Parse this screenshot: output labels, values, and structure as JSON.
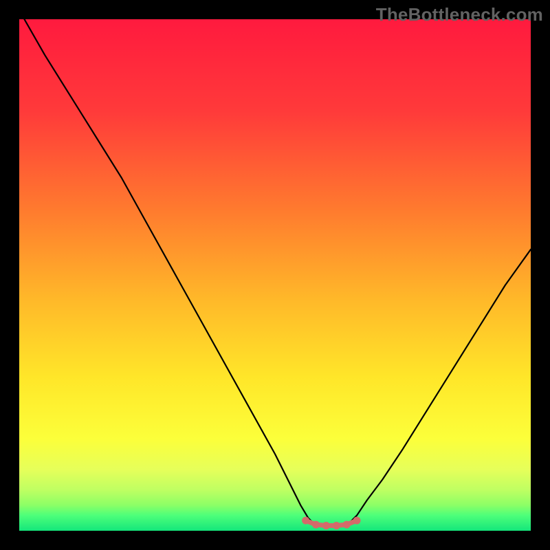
{
  "watermark": "TheBottleneck.com",
  "chart_data": {
    "type": "line",
    "title": "",
    "xlabel": "",
    "ylabel": "",
    "xlim": [
      0,
      100
    ],
    "ylim": [
      0,
      100
    ],
    "left_curve": {
      "x": [
        1,
        5,
        10,
        15,
        20,
        25,
        30,
        35,
        40,
        45,
        50,
        53,
        55,
        56.5,
        58
      ],
      "y": [
        100,
        93,
        85,
        77,
        69,
        60,
        51,
        42,
        33,
        24,
        15,
        9,
        5,
        2.5,
        1
      ]
    },
    "right_curve": {
      "x": [
        64,
        66,
        68,
        71,
        75,
        80,
        85,
        90,
        95,
        100
      ],
      "y": [
        1,
        3,
        6,
        10,
        16,
        24,
        32,
        40,
        48,
        55
      ]
    },
    "flat_segment": {
      "x": [
        56,
        58,
        60,
        62,
        64,
        66
      ],
      "y": [
        2,
        1.2,
        1,
        1,
        1.2,
        2
      ]
    },
    "flat_dots": {
      "x": [
        56,
        58,
        60,
        62,
        64,
        66
      ],
      "y": [
        2,
        1.2,
        1,
        1,
        1.2,
        2
      ]
    },
    "background": {
      "stops": [
        {
          "pct": 0,
          "color": "#ff1a3e"
        },
        {
          "pct": 18,
          "color": "#ff3a3a"
        },
        {
          "pct": 38,
          "color": "#ff7d2e"
        },
        {
          "pct": 55,
          "color": "#ffb929"
        },
        {
          "pct": 70,
          "color": "#ffe629"
        },
        {
          "pct": 82,
          "color": "#fcff3a"
        },
        {
          "pct": 88,
          "color": "#e6ff5a"
        },
        {
          "pct": 92,
          "color": "#bfff62"
        },
        {
          "pct": 95,
          "color": "#8cff66"
        },
        {
          "pct": 97,
          "color": "#4dff7a"
        },
        {
          "pct": 100,
          "color": "#14e67b"
        }
      ]
    },
    "colors": {
      "curve": "#000000",
      "flat_segment": "#d46a6a",
      "flat_dots": "#d46a6a"
    }
  }
}
